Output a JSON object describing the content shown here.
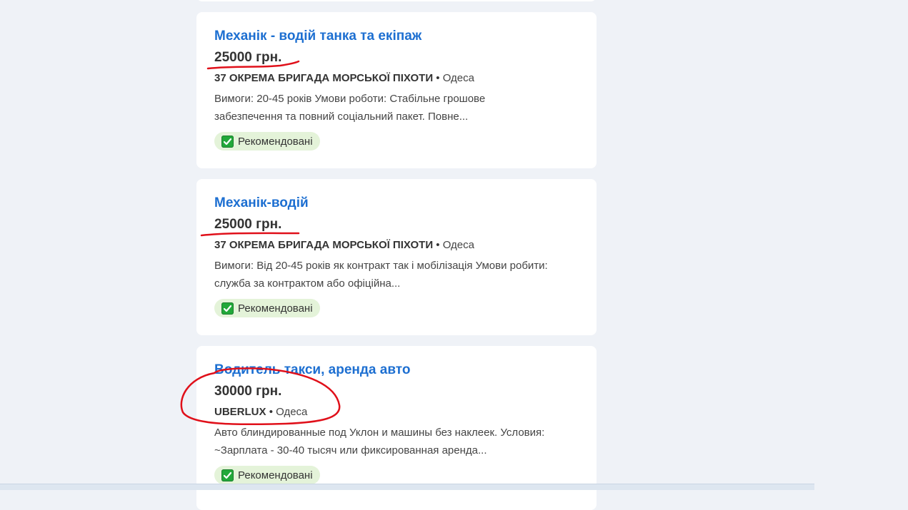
{
  "listings": [
    {
      "title": "Механік - водій танка та екіпаж",
      "salary": "25000 грн.",
      "company": "37 ОКРЕМА БРИГАДА МОРСЬКОЇ ПІХОТИ",
      "separator": "•",
      "city": "Одеса",
      "description_line1": "Вимоги: 20-45 років Умови роботи: Стабільне грошове",
      "description_line2": "забезпечення та повний соціальний пакет. Повне...",
      "badge": "Рекомендовані"
    },
    {
      "title": "Механік-водій",
      "salary": "25000 грн.",
      "company": "37 ОКРЕМА БРИГАДА МОРСЬКОЇ ПІХОТИ",
      "separator": "•",
      "city": "Одеса",
      "description_line1": "Вимоги: Від 20-45 років як контракт так і мобілізація Умови робити:",
      "description_line2": "служба за контрактом або офіційна...",
      "badge": "Рекомендовані"
    },
    {
      "title": "Водитель такси, аренда авто",
      "salary": "30000 грн.",
      "company": "UBERLUX",
      "separator": "•",
      "city": "Одеса",
      "description_line1": "Авто блиндированные под Уклон и машины без наклеек. Условия:",
      "description_line2": "~Зарплата - 30-40 тысяч или фиксированная аренда...",
      "badge": "Рекомендовані"
    }
  ],
  "icons": {
    "badge_icon": "check-mark-icon"
  },
  "colors": {
    "title": "#1d6fd1",
    "annotation": "#e0101a",
    "badge_bg": "#e4f3d9",
    "check": "#22a83a"
  }
}
